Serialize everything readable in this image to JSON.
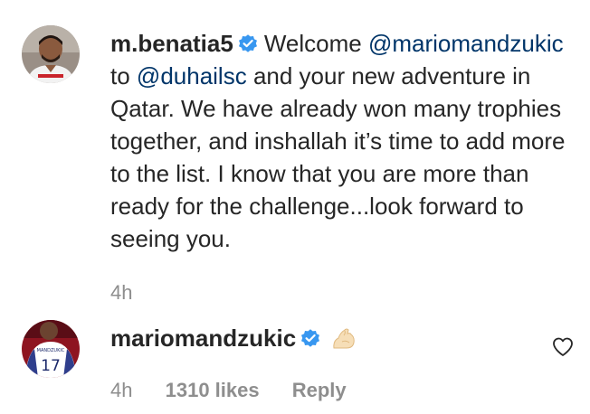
{
  "comments": [
    {
      "username": "m.benatia5",
      "verified": true,
      "text_parts": {
        "before": "Welcome ",
        "mention1": "@mariomandzukic",
        "mid": " to ",
        "mention2": "@duhailsc",
        "after": " and your new adventure in Qatar. We have already won many trophies together, and inshallah it’s time to add more to the list. I know that you are more than ready for the challenge...look forward to seeing you."
      },
      "time": "4h",
      "avatar_icon": "profile-photo"
    },
    {
      "username": "mariomandzukic",
      "verified": true,
      "emoji_icon": "flexed-biceps-icon",
      "time": "4h",
      "likes": "1310 likes",
      "reply_label": "Reply",
      "avatar_icon": "profile-photo",
      "avatar_jersey_number": "17",
      "avatar_jersey_name": "MANDZUKIC"
    }
  ],
  "colors": {
    "text": "#262626",
    "secondary": "#8e8e8e",
    "mention": "#003569",
    "verified": "#3897f0"
  },
  "heart_icon": "heart-outline-icon"
}
